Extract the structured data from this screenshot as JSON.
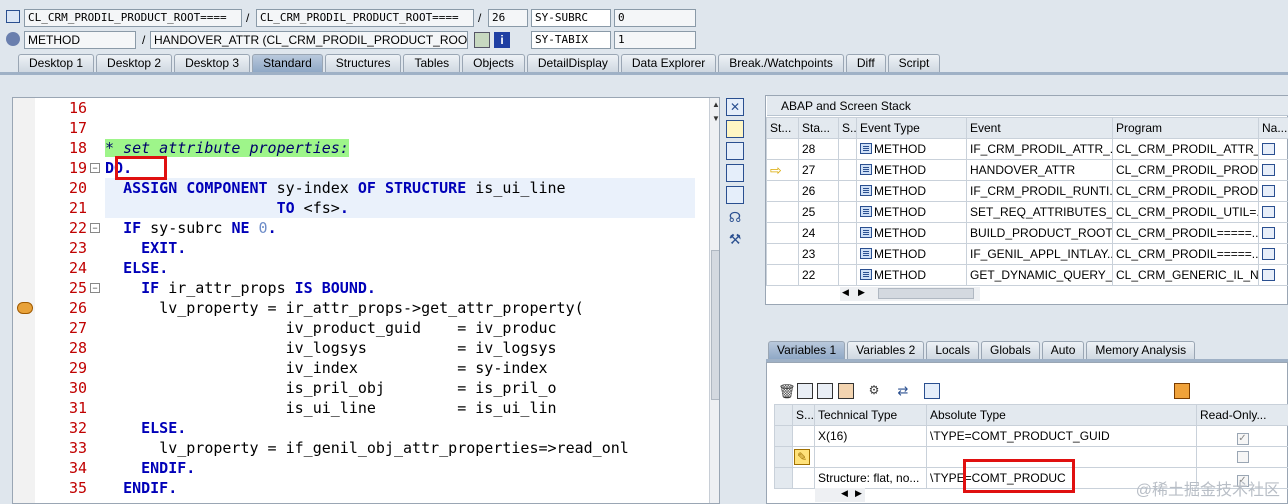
{
  "header": {
    "row1": {
      "class1": "CL_CRM_PRODIL_PRODUCT_ROOT====",
      "sep1": "/",
      "class2": "CL_CRM_PRODIL_PRODUCT_ROOT====",
      "sep2": "/",
      "line": "26",
      "sysvar": "SY-SUBRC",
      "sysval": "0"
    },
    "row2": {
      "kind": "METHOD",
      "sep": "/",
      "method": "HANDOVER_ATTR (CL_CRM_PRODIL_PRODUCT_ROOT)",
      "sysvar": "SY-TABIX",
      "sysval": "1"
    }
  },
  "tabs": [
    "Desktop 1",
    "Desktop 2",
    "Desktop 3",
    "Standard",
    "Structures",
    "Tables",
    "Objects",
    "DetailDisplay",
    "Data Explorer",
    "Break./Watchpoints",
    "Diff",
    "Script"
  ],
  "active_tab": "Standard",
  "editor": {
    "lines": [
      {
        "n": "16",
        "code": ""
      },
      {
        "n": "17",
        "code": ""
      },
      {
        "n": "18",
        "code": "* set attribute properties:"
      },
      {
        "n": "19",
        "code": "DO."
      },
      {
        "n": "20",
        "code": "ASSIGN COMPONENT sy-index OF STRUCTURE is_ui_line"
      },
      {
        "n": "21",
        "code": "TO <fs>."
      },
      {
        "n": "22",
        "code": "IF sy-subrc NE 0."
      },
      {
        "n": "23",
        "code": "EXIT."
      },
      {
        "n": "24",
        "code": "ELSE."
      },
      {
        "n": "25",
        "code": "IF ir_attr_props IS BOUND."
      },
      {
        "n": "26",
        "code": "lv_property = ir_attr_props->get_attr_property("
      },
      {
        "n": "27",
        "code": "iv_product_guid    = iv_produc"
      },
      {
        "n": "28",
        "code": "iv_logsys          = iv_logsys"
      },
      {
        "n": "29",
        "code": "iv_index           = sy-index"
      },
      {
        "n": "30",
        "code": "is_pril_obj        = is_pril_o"
      },
      {
        "n": "31",
        "code": "is_ui_line         = is_ui_lin"
      },
      {
        "n": "32",
        "code": "ELSE."
      },
      {
        "n": "33",
        "code": "lv_property = if_genil_obj_attr_properties=>read_onl"
      },
      {
        "n": "34",
        "code": "ENDIF."
      },
      {
        "n": "35",
        "code": "ENDIF."
      }
    ]
  },
  "stack": {
    "title": "ABAP and Screen Stack",
    "columns": [
      "St...",
      "Sta...",
      "S...",
      "Event Type",
      "Event",
      "Program",
      "Na..."
    ],
    "rows": [
      {
        "level": "28",
        "type": "METHOD",
        "event": "IF_CRM_PRODIL_ATTR_...",
        "program": "CL_CRM_PRODIL_ATTR_..."
      },
      {
        "level": "27",
        "type": "METHOD",
        "event": "HANDOVER_ATTR",
        "program": "CL_CRM_PRODIL_PRODU..."
      },
      {
        "level": "26",
        "type": "METHOD",
        "event": "IF_CRM_PRODIL_RUNTI...",
        "program": "CL_CRM_PRODIL_PRODU..."
      },
      {
        "level": "25",
        "type": "METHOD",
        "event": "SET_REQ_ATTRIBUTES_...",
        "program": "CL_CRM_PRODIL_UTIL=..."
      },
      {
        "level": "24",
        "type": "METHOD",
        "event": "BUILD_PRODUCT_ROOT_...",
        "program": "CL_CRM_PRODIL=====..."
      },
      {
        "level": "23",
        "type": "METHOD",
        "event": "IF_GENIL_APPL_INTLAY...",
        "program": "CL_CRM_PRODIL=====..."
      },
      {
        "level": "22",
        "type": "METHOD",
        "event": "GET_DYNAMIC_QUERY_...",
        "program": "CL_CRM_GENERIC_IL_NE..."
      }
    ],
    "current_row": "27"
  },
  "vars": {
    "tabs": [
      "Variables 1",
      "Variables 2",
      "Locals",
      "Globals",
      "Auto",
      "Memory Analysis"
    ],
    "active_tab": "Variables 1",
    "columns": [
      "S...",
      "Technical Type",
      "Absolute Type",
      "Read-Only..."
    ],
    "rows": [
      {
        "tech": "X(16)",
        "abs": "\\TYPE=COMT_PRODUCT_GUID",
        "ro": "✓"
      },
      {
        "tech": "",
        "abs": "",
        "ro": ""
      },
      {
        "tech": "Structure: flat, no...",
        "abs": "\\TYPE=COMT_PRODUC",
        "ro": "✓"
      }
    ]
  },
  "watermark": "@稀土掘金技术社区"
}
